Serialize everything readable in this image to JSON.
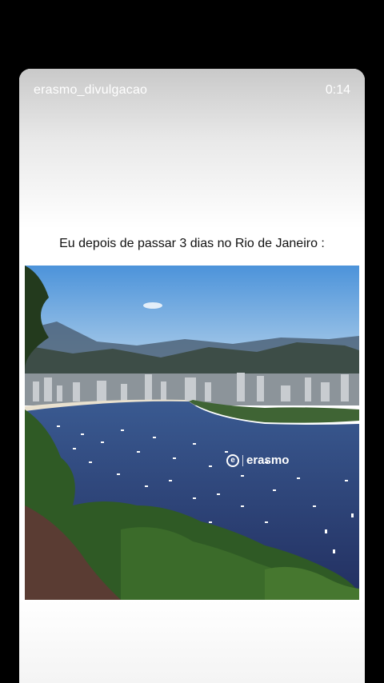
{
  "story": {
    "username": "erasmo_divulgacao",
    "timestamp": "0:14",
    "caption": "Eu depois de passar 3 dias no Rio de Janeiro :"
  },
  "video": {
    "watermark": "erasmo",
    "scene": "rio-bay"
  },
  "colors": {
    "sky": "#6aa6dd",
    "water": "#2c3f74",
    "foliage": "#2f5a25"
  }
}
